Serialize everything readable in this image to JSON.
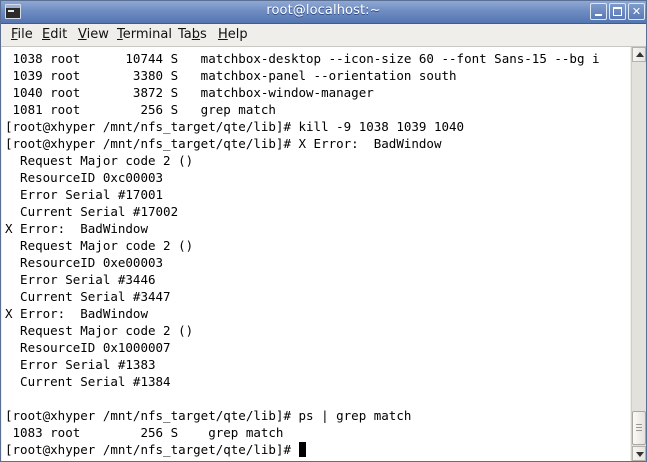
{
  "window": {
    "title": "root@localhost:~",
    "controls": {
      "minimize": "minimize",
      "maximize": "maximize",
      "close": "✕"
    }
  },
  "menu": {
    "items": [
      {
        "label": "File",
        "accel": "F",
        "rest": "ile"
      },
      {
        "label": "Edit",
        "accel": "E",
        "rest": "dit"
      },
      {
        "label": "View",
        "accel": "V",
        "rest": "iew"
      },
      {
        "label": "Terminal",
        "accel": "T",
        "rest": "erminal"
      },
      {
        "label": "Tabs",
        "pre": "Ta",
        "accel": "b",
        "rest": "s"
      },
      {
        "label": "Help",
        "accel": "H",
        "rest": "elp"
      }
    ]
  },
  "terminal": {
    "lines": [
      " 1038 root      10744 S   matchbox-desktop --icon-size 60 --font Sans-15 --bg i",
      " 1039 root       3380 S   matchbox-panel --orientation south",
      " 1040 root       3872 S   matchbox-window-manager",
      " 1081 root        256 S   grep match",
      "[root@xhyper /mnt/nfs_target/qte/lib]# kill -9 1038 1039 1040",
      "[root@xhyper /mnt/nfs_target/qte/lib]# X Error:  BadWindow",
      "  Request Major code 2 ()",
      "  ResourceID 0xc00003",
      "  Error Serial #17001",
      "  Current Serial #17002",
      "X Error:  BadWindow",
      "  Request Major code 2 ()",
      "  ResourceID 0xe00003",
      "  Error Serial #3446",
      "  Current Serial #3447",
      "X Error:  BadWindow",
      "  Request Major code 2 ()",
      "  ResourceID 0x1000007",
      "  Error Serial #1383",
      "  Current Serial #1384",
      "",
      "[root@xhyper /mnt/nfs_target/qte/lib]# ps | grep match",
      " 1083 root        256 S    grep match",
      "[root@xhyper /mnt/nfs_target/qte/lib]# "
    ]
  },
  "colors": {
    "titlebar": "#6f8cc2",
    "terminal_bg": "#ffffff",
    "terminal_fg": "#000000"
  }
}
